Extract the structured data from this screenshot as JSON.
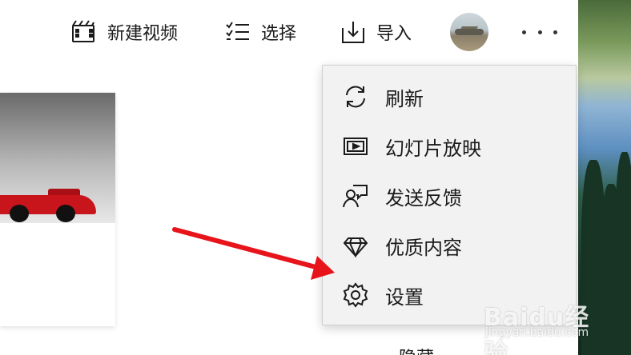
{
  "toolbar": {
    "new_video_label": "新建视频",
    "select_label": "选择",
    "import_label": "导入",
    "avatar_icon": "user-avatar",
    "more_icon": "more-ellipsis-icon"
  },
  "menu": {
    "items": [
      {
        "label": "刷新",
        "icon": "refresh-icon"
      },
      {
        "label": "幻灯片放映",
        "icon": "slideshow-icon"
      },
      {
        "label": "发送反馈",
        "icon": "feedback-icon"
      },
      {
        "label": "优质内容",
        "icon": "diamond-icon"
      },
      {
        "label": "设置",
        "icon": "settings-gear-icon"
      }
    ]
  },
  "partial_item": {
    "label": "隐藏"
  },
  "watermark": {
    "main": "Baidu经验",
    "sub": "jingyan.baidu.com"
  },
  "colors": {
    "menu_background": "#f2f2f2",
    "arrow": "#e8141b",
    "toolbar_background": "#ffffff"
  }
}
